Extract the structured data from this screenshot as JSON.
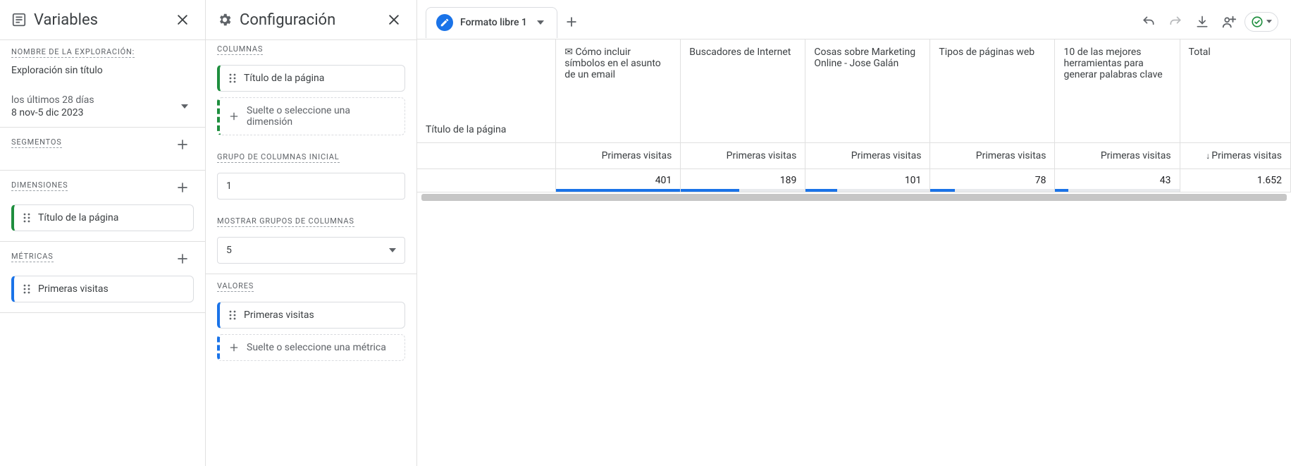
{
  "variables": {
    "panel_title": "Variables",
    "exploration_name_label": "NOMBRE DE LA EXPLORACIÓN:",
    "exploration_name": "Exploración sin título",
    "date_preset": "los últimos 28 días",
    "date_range": "8 nov-5 dic 2023",
    "segments_label": "SEGMENTOS",
    "dimensions_label": "DIMENSIONES",
    "dimension_chip": "Título de la página",
    "metrics_label": "MÉTRICAS",
    "metric_chip": "Primeras visitas"
  },
  "config": {
    "panel_title": "Configuración",
    "columns_label": "COLUMNAS",
    "column_chip": "Título de la página",
    "drop_dimension": "Suelte o seleccione una dimensión",
    "col_group_start_label": "GRUPO DE COLUMNAS INICIAL",
    "col_group_start_value": "1",
    "show_col_groups_label": "MOSTRAR GRUPOS DE COLUMNAS",
    "show_col_groups_value": "5",
    "values_label": "VALORES",
    "value_chip": "Primeras visitas",
    "drop_metric": "Suelte o seleccione una métrica"
  },
  "tabs": {
    "active_tab_name": "Formato libre 1"
  },
  "table": {
    "row_header_label": "Título de la página",
    "metric_label": "Primeras visitas",
    "total_header": "Total",
    "sort_metric_label": "Primeras visitas",
    "columns": [
      "✉ Cómo incluir símbolos en el asunto de un email",
      "Buscadores de Internet",
      "Cosas sobre Marketing Online - Jose Galán",
      "Tipos de páginas web",
      "10 de las mejores herramientas para generar palabras clave"
    ],
    "values": [
      401,
      189,
      101,
      78,
      43
    ],
    "total_value": "1.652"
  },
  "chart_data": {
    "type": "bar",
    "categories": [
      "✉ Cómo incluir símbolos en el asunto de un email",
      "Buscadores de Internet",
      "Cosas sobre Marketing Online - Jose Galán",
      "Tipos de páginas web",
      "10 de las mejores herramientas para generar palabras clave"
    ],
    "values": [
      401,
      189,
      101,
      78,
      43
    ],
    "total": 1652,
    "metric": "Primeras visitas",
    "dimension": "Título de la página"
  }
}
